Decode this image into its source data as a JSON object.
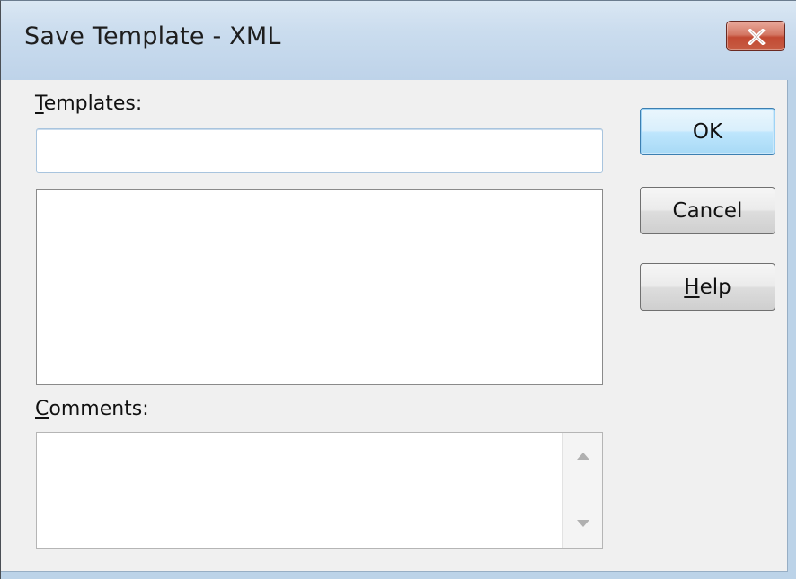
{
  "window": {
    "title": "Save Template - XML"
  },
  "templates": {
    "label_mnemonic": "T",
    "label_rest": "emplates:",
    "value": "",
    "list_items": []
  },
  "comments": {
    "label_mnemonic": "C",
    "label_rest": "omments:",
    "value": ""
  },
  "buttons": {
    "ok": "OK",
    "cancel": "Cancel",
    "help_mnemonic": "H",
    "help_rest": "elp"
  },
  "icons": {
    "close": "close-icon",
    "scroll_up": "scroll-up-arrow-icon",
    "scroll_down": "scroll-down-arrow-icon"
  },
  "colors": {
    "close_button": "#c75d44",
    "default_button_border": "#3c7fb1",
    "dialog_face": "#f0f0f0",
    "titlebar": "#cadcee"
  }
}
